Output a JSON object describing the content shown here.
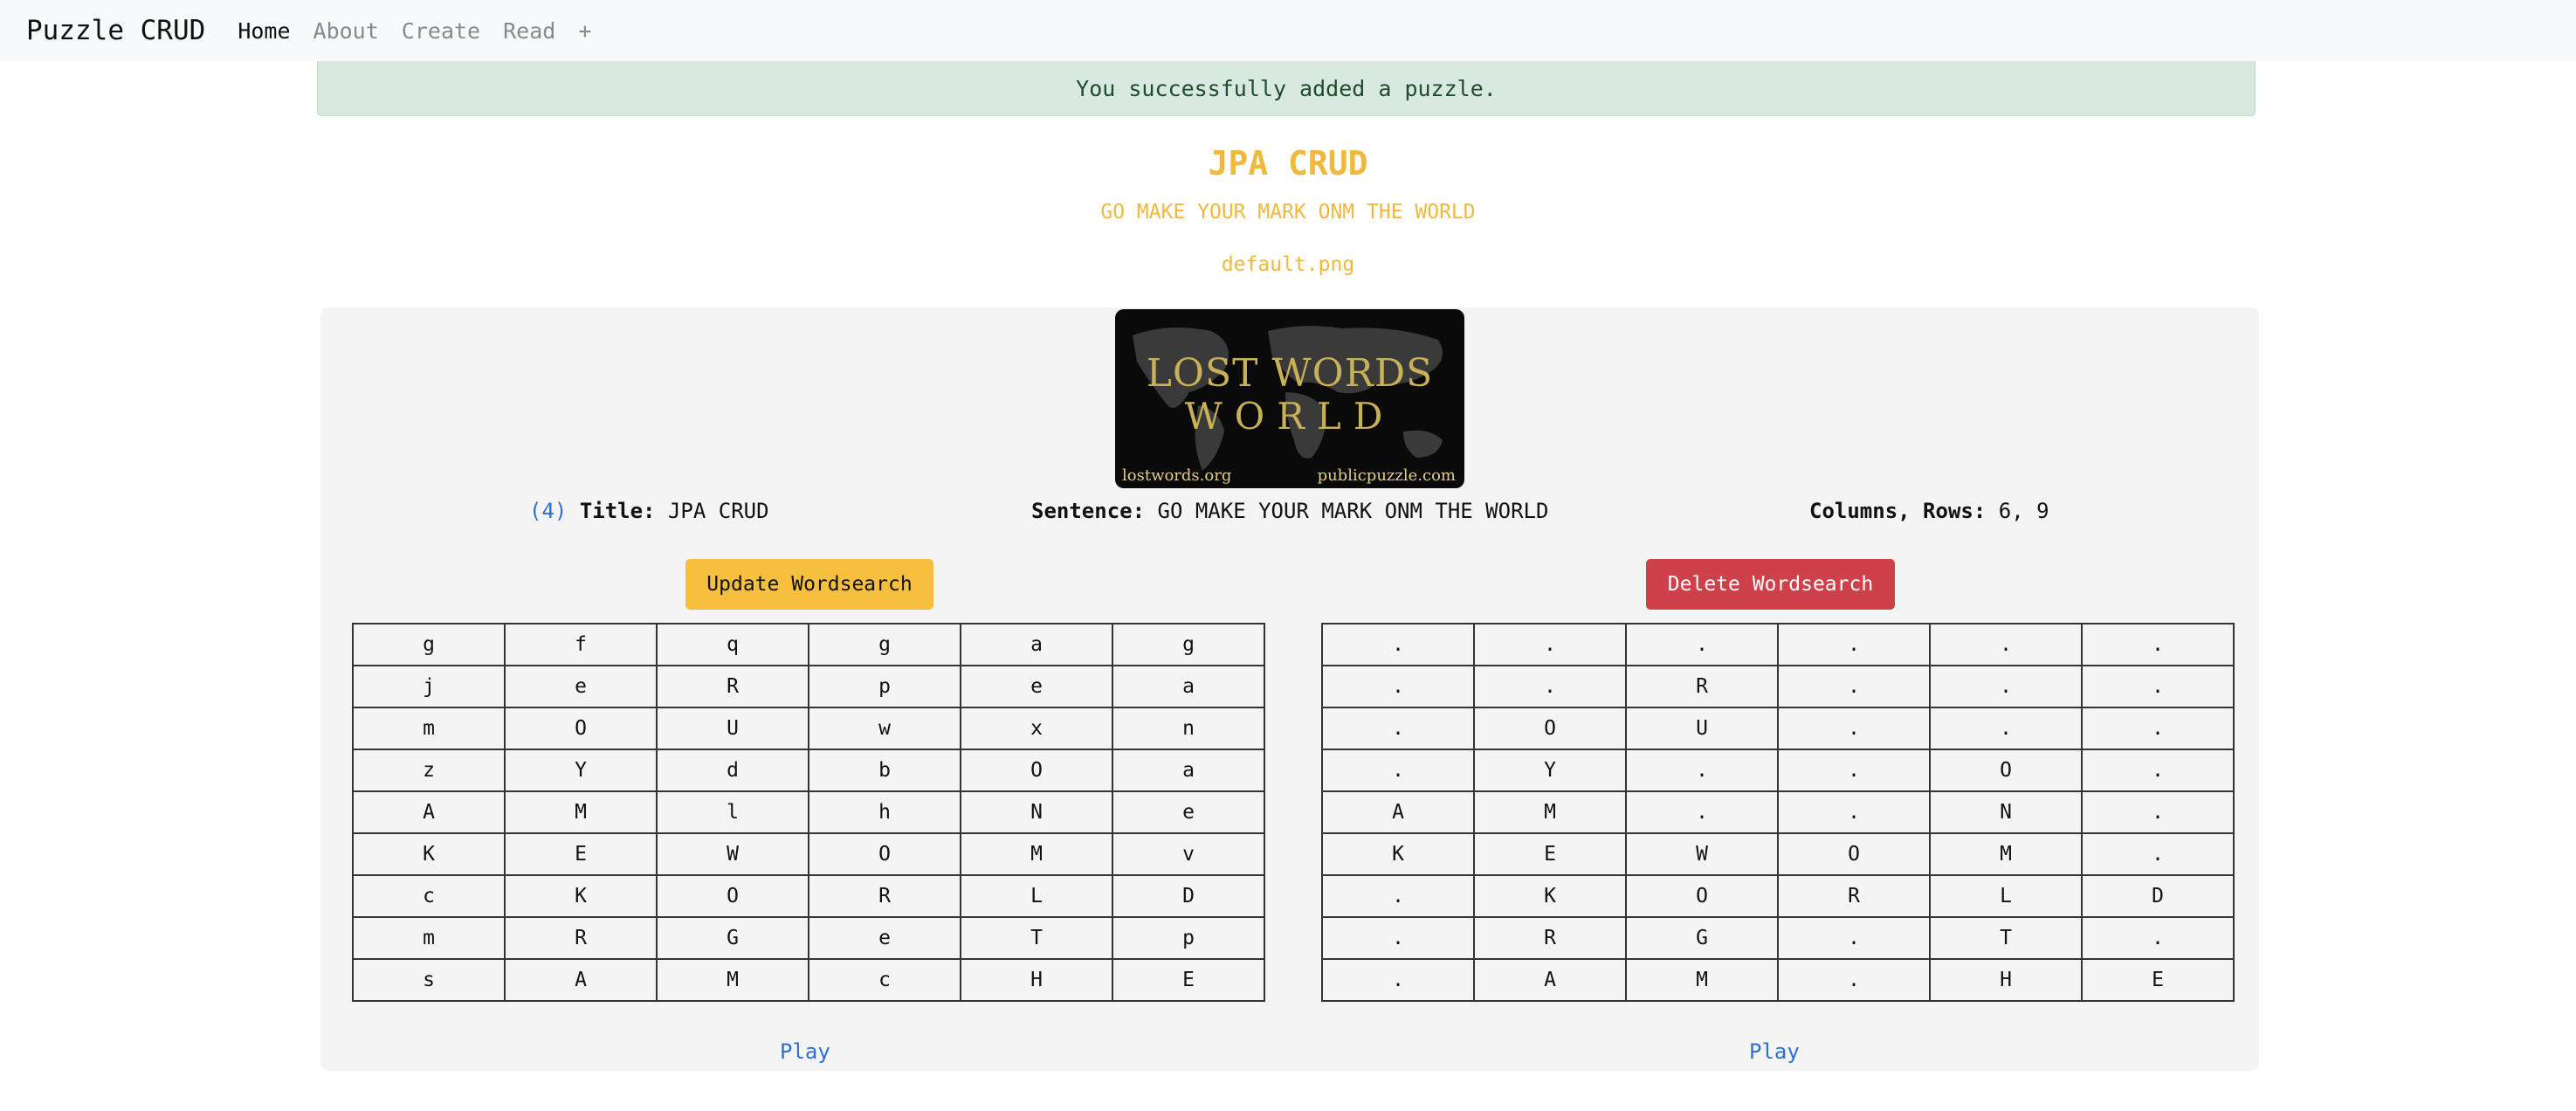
{
  "navbar": {
    "brand": "Puzzle CRUD",
    "links": [
      "Home",
      "About",
      "Create",
      "Read"
    ],
    "plus": "+"
  },
  "alert": {
    "message": "You successfully added a puzzle."
  },
  "puzzle": {
    "title": "JPA CRUD",
    "sentence": "GO MAKE YOUR MARK ONM THE WORLD",
    "image": "default.png",
    "id_label": "(4)",
    "title_label": "Title:",
    "sentence_label": "Sentence:",
    "dims_label": "Columns, Rows:",
    "dims_value": "6, 9"
  },
  "logo": {
    "line1": "LOST WORDS",
    "line2": "WORLD",
    "footer_left": "lostwords.org",
    "footer_right": "publicpuzzle.com"
  },
  "buttons": {
    "update": "Update Wordsearch",
    "delete": "Delete Wordsearch"
  },
  "grid_full": [
    [
      "g",
      "f",
      "q",
      "g",
      "a",
      "g"
    ],
    [
      "j",
      "e",
      "R",
      "p",
      "e",
      "a"
    ],
    [
      "m",
      "O",
      "U",
      "w",
      "x",
      "n"
    ],
    [
      "z",
      "Y",
      "d",
      "b",
      "O",
      "a"
    ],
    [
      "A",
      "M",
      "l",
      "h",
      "N",
      "e"
    ],
    [
      "K",
      "E",
      "W",
      "O",
      "M",
      "v"
    ],
    [
      "c",
      "K",
      "O",
      "R",
      "L",
      "D"
    ],
    [
      "m",
      "R",
      "G",
      "e",
      "T",
      "p"
    ],
    [
      "s",
      "A",
      "M",
      "c",
      "H",
      "E"
    ]
  ],
  "grid_solution": [
    [
      ".",
      ".",
      ".",
      ".",
      ".",
      "."
    ],
    [
      ".",
      ".",
      "R",
      ".",
      ".",
      "."
    ],
    [
      ".",
      "O",
      "U",
      ".",
      ".",
      "."
    ],
    [
      ".",
      "Y",
      ".",
      ".",
      "O",
      "."
    ],
    [
      "A",
      "M",
      ".",
      ".",
      "N",
      "."
    ],
    [
      "K",
      "E",
      "W",
      "O",
      "M",
      "."
    ],
    [
      ".",
      "K",
      "O",
      "R",
      "L",
      "D"
    ],
    [
      ".",
      "R",
      "G",
      ".",
      "T",
      "."
    ],
    [
      ".",
      "A",
      "M",
      ".",
      "H",
      "E"
    ]
  ],
  "play_left": "Play",
  "play_right": "Play",
  "colors": {
    "accent": "#f0b93d",
    "success_bg": "#d8eadf",
    "danger": "#cf414a",
    "warning": "#f6bf3d",
    "link": "#2f6fd1"
  }
}
